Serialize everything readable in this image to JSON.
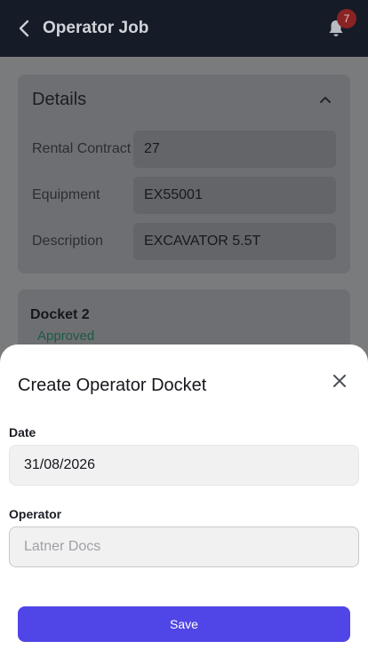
{
  "header": {
    "title": "Operator Job",
    "notification_count": "7"
  },
  "details": {
    "title": "Details",
    "rows": [
      {
        "label": "Rental Contract",
        "value": "27"
      },
      {
        "label": "Equipment",
        "value": "EX55001"
      },
      {
        "label": "Description",
        "value": "EXCAVATOR 5.5T"
      }
    ]
  },
  "docket": {
    "title": "Docket 2",
    "status": "Approved"
  },
  "modal": {
    "title": "Create Operator Docket",
    "date_label": "Date",
    "date_value": "31/08/2026",
    "operator_label": "Operator",
    "operator_placeholder": "Latner Docs",
    "save_label": "Save"
  },
  "colors": {
    "accent": "#5045e6",
    "header_bg": "#151b27",
    "badge": "#e53935",
    "approved": "#2e8b6a"
  },
  "icons": [
    "back-arrow-icon",
    "bell-icon",
    "chevron-up-icon",
    "close-icon"
  ]
}
